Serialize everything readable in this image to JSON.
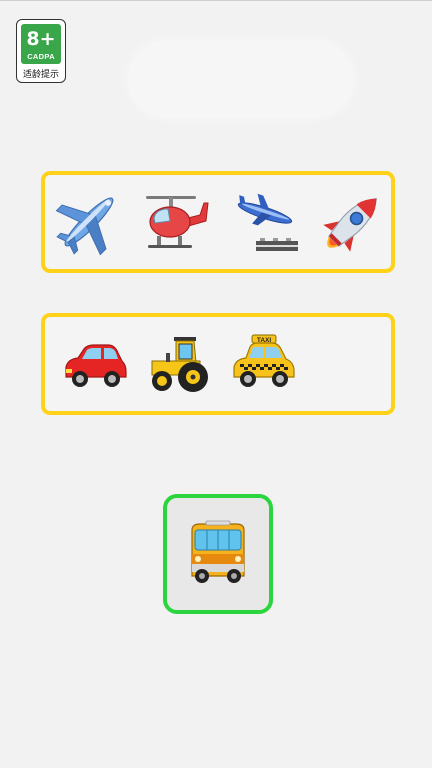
{
  "age_rating": {
    "age": "8+",
    "org": "CADPA",
    "hint": "适龄提示"
  },
  "categories": [
    {
      "id": "air",
      "items": [
        {
          "name": "airplane",
          "icon": "airplane-icon"
        },
        {
          "name": "helicopter",
          "icon": "helicopter-icon"
        },
        {
          "name": "airplane-arriving",
          "icon": "airplane-landing-icon"
        },
        {
          "name": "rocket",
          "icon": "rocket-icon"
        }
      ]
    },
    {
      "id": "ground",
      "items": [
        {
          "name": "car",
          "icon": "red-car-icon"
        },
        {
          "name": "tractor",
          "icon": "tractor-icon"
        },
        {
          "name": "taxi",
          "icon": "taxi-icon"
        }
      ]
    }
  ],
  "taxi_sign": "TAXI",
  "current_item": {
    "name": "bus",
    "icon": "bus-icon"
  },
  "colors": {
    "row_border": "#ffd21a",
    "card_border": "#2bd53d",
    "background": "#f2f2f2",
    "badge_green": "#3aa64a"
  }
}
